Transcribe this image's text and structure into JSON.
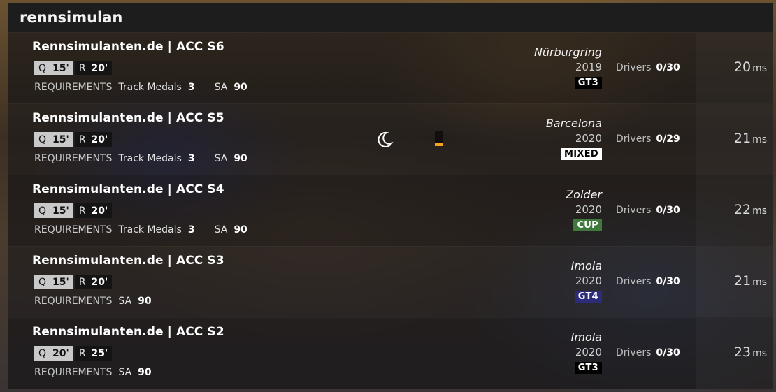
{
  "header": {
    "title": "rennsimulan"
  },
  "servers": [
    {
      "name": "Rennsimulanten.de | ACC S6",
      "qualy": {
        "label": "Q",
        "mins": "15'"
      },
      "race": {
        "label": "R",
        "mins": "20'"
      },
      "requirements_label": "REQUIREMENTS",
      "requirements": [
        {
          "name": "Track Medals",
          "value": "3"
        },
        {
          "name": "SA",
          "value": "90"
        }
      ],
      "track": "Nürburgring",
      "year": "2019",
      "car_class": "GT3",
      "drivers_label": "Drivers",
      "drivers": "0/30",
      "ping": "20",
      "ping_unit": "ms"
    },
    {
      "name": "Rennsimulanten.de | ACC S5",
      "qualy": {
        "label": "Q",
        "mins": "15'"
      },
      "race": {
        "label": "R",
        "mins": "20'"
      },
      "requirements_label": "REQUIREMENTS",
      "requirements": [
        {
          "name": "Track Medals",
          "value": "3"
        },
        {
          "name": "SA",
          "value": "90"
        }
      ],
      "track": "Barcelona",
      "year": "2020",
      "car_class": "MIXED",
      "drivers_label": "Drivers",
      "drivers": "0/29",
      "ping": "21",
      "ping_unit": "ms",
      "icons": [
        "moon-icon",
        "signal-bar-icon"
      ]
    },
    {
      "name": "Rennsimulanten.de | ACC S4",
      "qualy": {
        "label": "Q",
        "mins": "15'"
      },
      "race": {
        "label": "R",
        "mins": "20'"
      },
      "requirements_label": "REQUIREMENTS",
      "requirements": [
        {
          "name": "Track Medals",
          "value": "3"
        },
        {
          "name": "SA",
          "value": "90"
        }
      ],
      "track": "Zolder",
      "year": "2020",
      "car_class": "CUP",
      "drivers_label": "Drivers",
      "drivers": "0/30",
      "ping": "22",
      "ping_unit": "ms"
    },
    {
      "name": "Rennsimulanten.de | ACC S3",
      "qualy": {
        "label": "Q",
        "mins": "15'"
      },
      "race": {
        "label": "R",
        "mins": "20'"
      },
      "requirements_label": "REQUIREMENTS",
      "requirements": [
        {
          "name": "SA",
          "value": "90"
        }
      ],
      "track": "Imola",
      "year": "2020",
      "car_class": "GT4",
      "drivers_label": "Drivers",
      "drivers": "0/30",
      "ping": "21",
      "ping_unit": "ms"
    },
    {
      "name": "Rennsimulanten.de | ACC S2",
      "qualy": {
        "label": "Q",
        "mins": "20'"
      },
      "race": {
        "label": "R",
        "mins": "25'"
      },
      "requirements_label": "REQUIREMENTS",
      "requirements": [
        {
          "name": "SA",
          "value": "90"
        }
      ],
      "track": "Imola",
      "year": "2020",
      "car_class": "GT3",
      "drivers_label": "Drivers",
      "drivers": "0/30",
      "ping": "23",
      "ping_unit": "ms"
    }
  ],
  "colors": {
    "mixed_badge": "#ffffff",
    "cup_badge": "#3f7a3c",
    "gt4_badge": "#2c2c7a",
    "gt3_badge": "#000000",
    "signal_bar": "#f2a51f"
  }
}
